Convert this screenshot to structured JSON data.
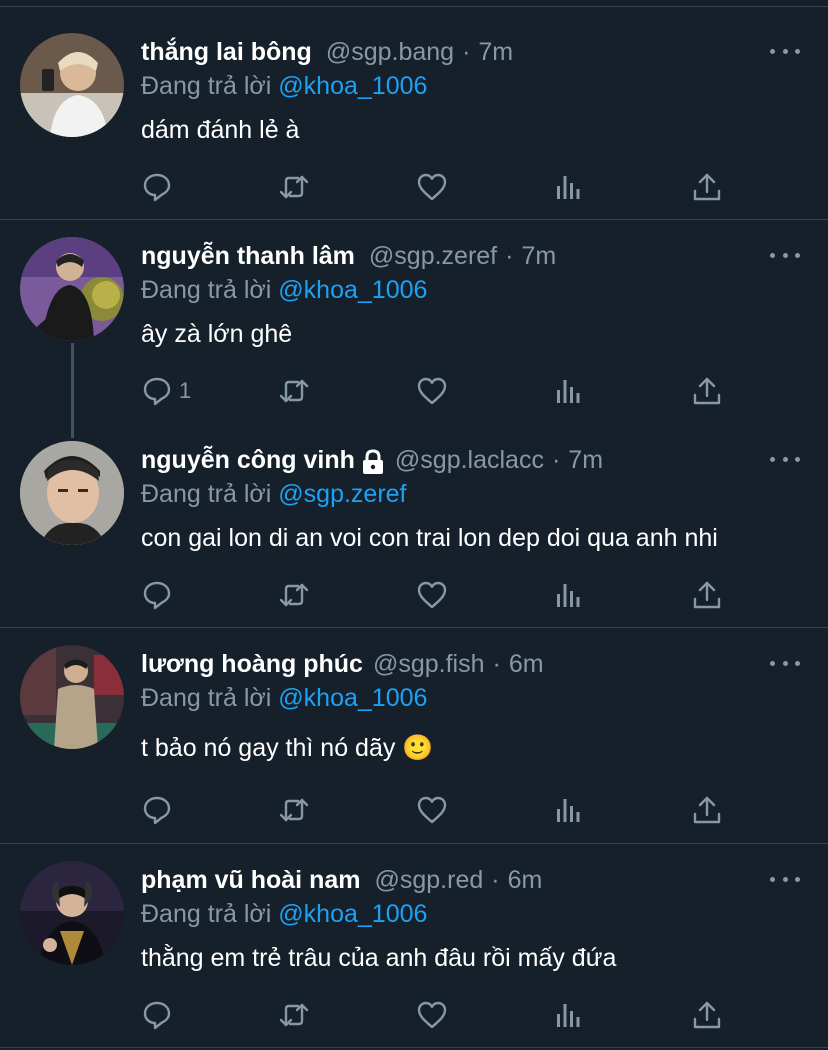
{
  "reply_prefix": "Đang trả lời",
  "colors": {
    "background": "#15202b",
    "text": "#ffffff",
    "secondary": "#8899a6",
    "link": "#1da1f2",
    "divider": "#38444d"
  },
  "icons": {
    "reply": "comment-icon",
    "retweet": "retweet-icon",
    "like": "heart-icon",
    "analytics": "analytics-icon",
    "share": "share-icon",
    "more": "more-icon",
    "protected": "lock-icon"
  },
  "tweets": [
    {
      "name": "thắng lai bông",
      "handle": "@sgp.bang",
      "sep": "·",
      "time": "7m",
      "reply_to": "@khoa_1006",
      "text": "dám đánh lẻ à",
      "reply_count": "",
      "protected": false
    },
    {
      "name": "nguyễn thanh lâm",
      "handle": "@sgp.zeref",
      "sep": "·",
      "time": "7m",
      "reply_to": "@khoa_1006",
      "text": "ây zà lớn ghê",
      "reply_count": "1",
      "protected": false
    },
    {
      "name": "nguyễn công vinh",
      "handle": "@sgp.laclacc",
      "sep": "·",
      "time": "7m",
      "reply_to": "@sgp.zeref",
      "text": "con gai lon di an voi con trai lon dep doi qua anh nhi",
      "reply_count": "",
      "protected": true
    },
    {
      "name": "lương hoàng phúc",
      "handle": "@sgp.fish",
      "sep": "·",
      "time": "6m",
      "reply_to": "@khoa_1006",
      "text": "t bảo nó gay thì nó dãy 🙂",
      "reply_count": "",
      "protected": false
    },
    {
      "name": "phạm vũ hoài nam",
      "handle": "@sgp.red",
      "sep": "·",
      "time": "6m",
      "reply_to": "@khoa_1006",
      "text": "thằng em trẻ trâu của anh đâu rồi mấy đứa",
      "reply_count": "",
      "protected": false
    }
  ]
}
